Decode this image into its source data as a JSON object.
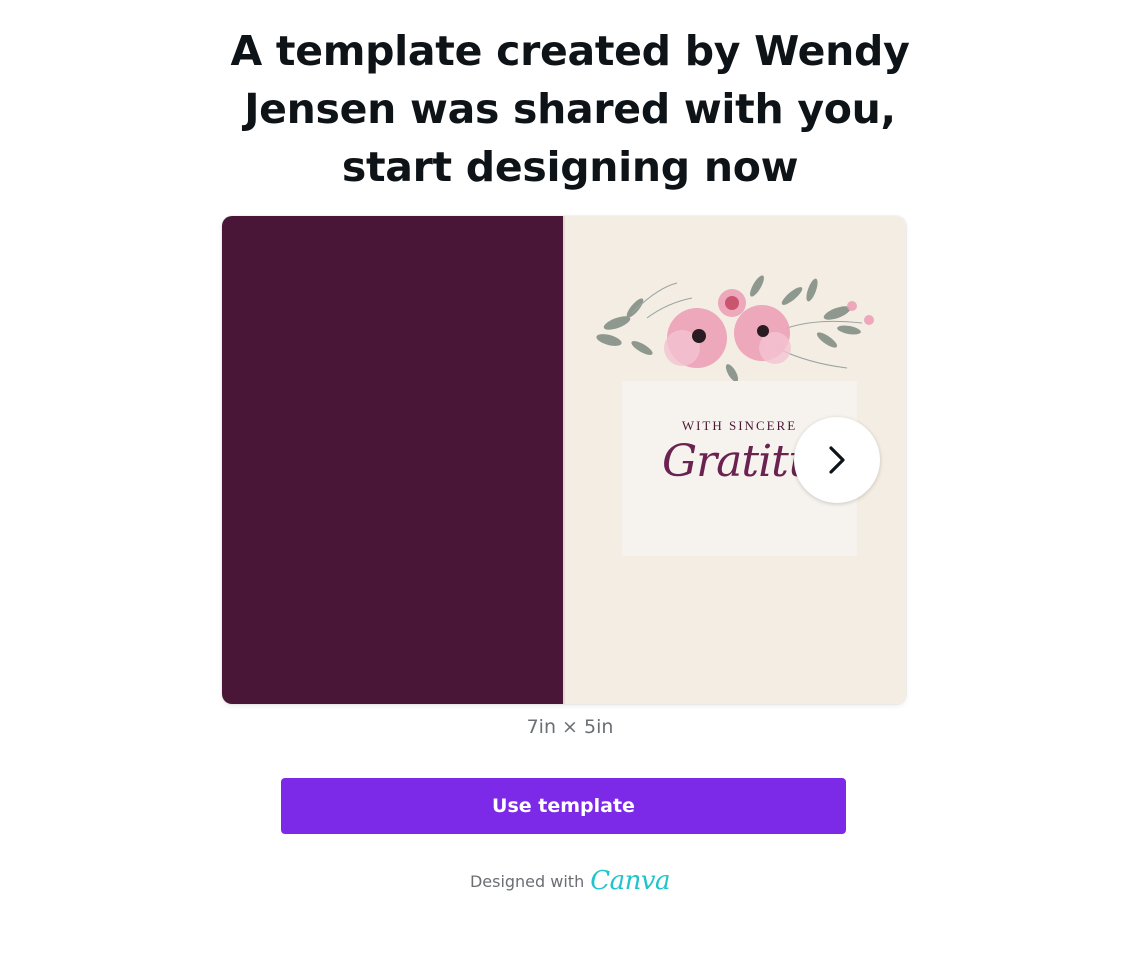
{
  "headline": "A template created by Wendy Jensen was shared with you, start designing now",
  "preview": {
    "card_eyebrow": "WITH SINCERE",
    "card_script": "Gratitude",
    "colors": {
      "cover": "#4a1638",
      "inside": "#f3ede3",
      "script": "#6a2350"
    }
  },
  "dimensions": "7in × 5in",
  "actions": {
    "use_template": "Use template"
  },
  "footer": {
    "designed_with": "Designed with",
    "brand": "Canva",
    "brand_color": "#20c4cb"
  },
  "colors": {
    "accent": "#7d2ae8"
  },
  "icons": {
    "next": "chevron-right-icon"
  }
}
